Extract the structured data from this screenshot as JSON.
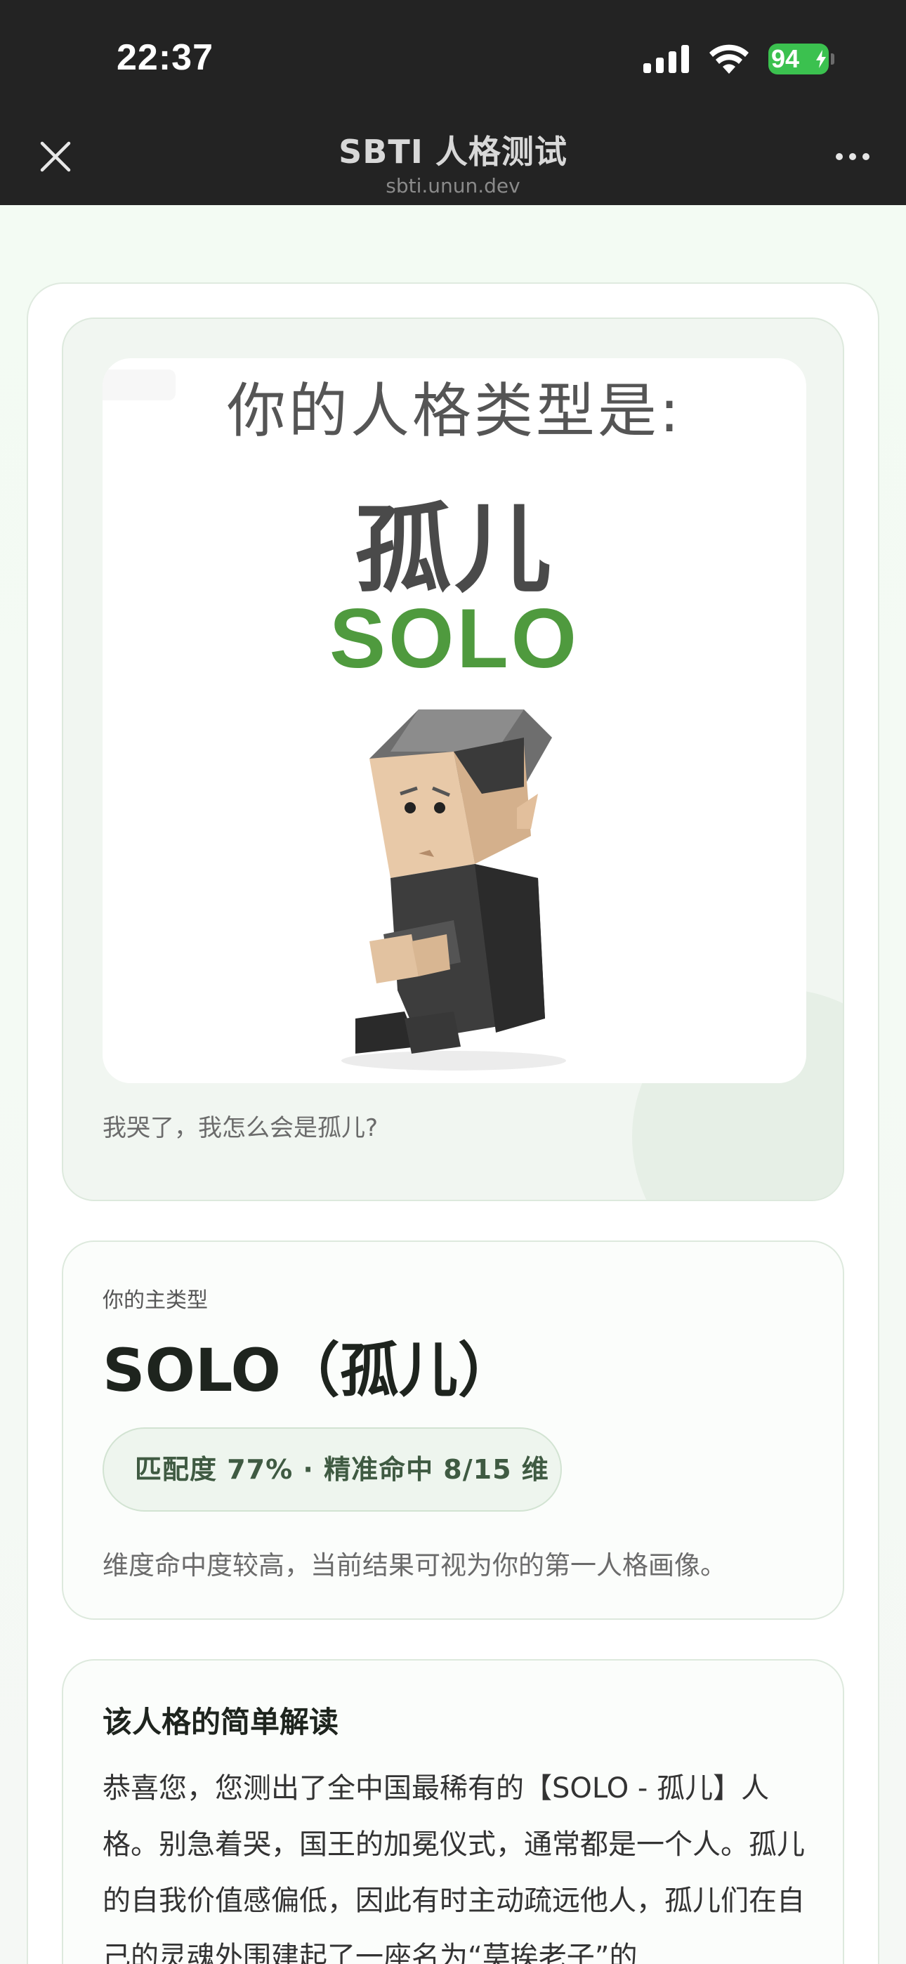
{
  "status": {
    "time": "22:37",
    "battery": "94"
  },
  "nav": {
    "title": "SBTI 人格测试",
    "domain": "sbti.unun.dev"
  },
  "hero": {
    "heading": "你的人格类型是:",
    "name_cn": "孤儿",
    "name_en": "SOLO",
    "caption": "我哭了，我怎么会是孤儿?"
  },
  "type_card": {
    "label": "你的主类型",
    "name": "SOLO（孤儿）",
    "match": "匹配度 77% · 精准命中 8/15 维",
    "note": "维度命中度较高，当前结果可视为你的第一人格画像。"
  },
  "description": {
    "title": "该人格的简单解读",
    "body": "恭喜您，您测出了全中国最稀有的【SOLO - 孤儿】人格。别急着哭，国王的加冕仪式，通常都是一个人。孤儿的自我价值感偏低，因此有时主动疏远他人，孤儿们在自己的灵魂外围建起了一座名为“莫挨老子”的"
  },
  "colors": {
    "accent": "#4f9a3e",
    "chrome": "#232323",
    "battery": "#3bc14f"
  },
  "icons": [
    "close-icon",
    "more-icon",
    "signal-icon",
    "wifi-icon",
    "battery-icon",
    "charging-icon"
  ]
}
